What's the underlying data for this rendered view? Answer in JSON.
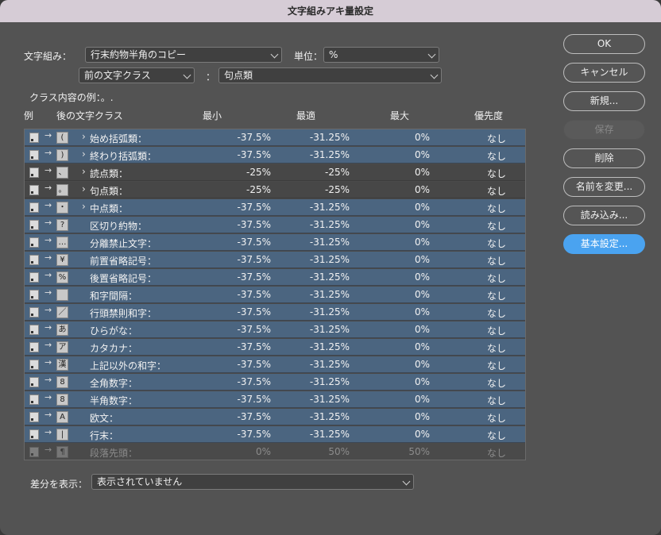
{
  "window": {
    "title": "文字組みアキ量設定"
  },
  "form": {
    "mojikumi_label": "文字組み：",
    "mojikumi_value": "行末約物半角のコピー",
    "unit_label": "単位：",
    "unit_value": "%",
    "prev_class_value": "前の文字クラス",
    "colon": "：",
    "class_value": "句点類",
    "example_label": "クラス内容の例：。.",
    "diff_label": "差分を表示：",
    "diff_value": "表示されていません"
  },
  "table": {
    "headers": {
      "example": "例",
      "next_class": "後の文字クラス",
      "min": "最小",
      "optimal": "最適",
      "max": "最大",
      "priority": "優先度"
    },
    "rows": [
      {
        "icon": "(",
        "name": "始め括弧類：",
        "min": "-37.5%",
        "opt": "-31.25%",
        "max": "0%",
        "pri": "なし",
        "expander": "›"
      },
      {
        "icon": ")",
        "name": "終わり括弧類：",
        "min": "-37.5%",
        "opt": "-31.25%",
        "max": "0%",
        "pri": "なし",
        "expander": "›"
      },
      {
        "icon": "、",
        "name": "読点類：",
        "min": "-25%",
        "opt": "-25%",
        "max": "0%",
        "pri": "なし",
        "expander": "›"
      },
      {
        "icon": "。",
        "name": "句点類：",
        "min": "-25%",
        "opt": "-25%",
        "max": "0%",
        "pri": "なし",
        "expander": "›"
      },
      {
        "icon": "・",
        "name": "中点類：",
        "min": "-37.5%",
        "opt": "-31.25%",
        "max": "0%",
        "pri": "なし",
        "expander": "›"
      },
      {
        "icon": "?",
        "name": "区切り約物：",
        "min": "-37.5%",
        "opt": "-31.25%",
        "max": "0%",
        "pri": "なし",
        "expander": ""
      },
      {
        "icon": "…",
        "name": "分離禁止文字：",
        "min": "-37.5%",
        "opt": "-31.25%",
        "max": "0%",
        "pri": "なし",
        "expander": ""
      },
      {
        "icon": "¥",
        "name": "前置省略記号：",
        "min": "-37.5%",
        "opt": "-31.25%",
        "max": "0%",
        "pri": "なし",
        "expander": ""
      },
      {
        "icon": "%",
        "name": "後置省略記号：",
        "min": "-37.5%",
        "opt": "-31.25%",
        "max": "0%",
        "pri": "なし",
        "expander": ""
      },
      {
        "icon": "",
        "name": "和字間隔：",
        "min": "-37.5%",
        "opt": "-31.25%",
        "max": "0%",
        "pri": "なし",
        "expander": ""
      },
      {
        "icon": "／",
        "name": "行頭禁則和字：",
        "min": "-37.5%",
        "opt": "-31.25%",
        "max": "0%",
        "pri": "なし",
        "expander": ""
      },
      {
        "icon": "あ",
        "name": "ひらがな：",
        "min": "-37.5%",
        "opt": "-31.25%",
        "max": "0%",
        "pri": "なし",
        "expander": ""
      },
      {
        "icon": "ア",
        "name": "カタカナ：",
        "min": "-37.5%",
        "opt": "-31.25%",
        "max": "0%",
        "pri": "なし",
        "expander": ""
      },
      {
        "icon": "漢",
        "name": "上記以外の和字：",
        "min": "-37.5%",
        "opt": "-31.25%",
        "max": "0%",
        "pri": "なし",
        "expander": ""
      },
      {
        "icon": "8",
        "name": "全角数字：",
        "min": "-37.5%",
        "opt": "-31.25%",
        "max": "0%",
        "pri": "なし",
        "expander": ""
      },
      {
        "icon": "8",
        "name": "半角数字：",
        "min": "-37.5%",
        "opt": "-31.25%",
        "max": "0%",
        "pri": "なし",
        "expander": ""
      },
      {
        "icon": "A",
        "name": "欧文：",
        "min": "-37.5%",
        "opt": "-31.25%",
        "max": "0%",
        "pri": "なし",
        "expander": ""
      },
      {
        "icon": "|",
        "name": "行末：",
        "min": "-37.5%",
        "opt": "-31.25%",
        "max": "0%",
        "pri": "なし",
        "expander": ""
      },
      {
        "icon": "¶",
        "name": "段落先頭：",
        "min": "0%",
        "opt": "50%",
        "max": "50%",
        "pri": "なし",
        "expander": ""
      }
    ]
  },
  "buttons": {
    "ok": "OK",
    "cancel": "キャンセル",
    "new": "新規...",
    "save": "保存",
    "delete": "削除",
    "rename": "名前を変更...",
    "load": "読み込み...",
    "basic": "基本設定..."
  }
}
